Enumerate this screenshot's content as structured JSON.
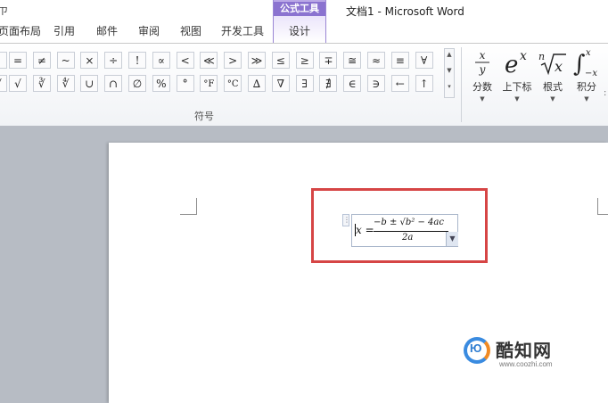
{
  "window": {
    "title": "文档1 - Microsoft Word"
  },
  "tabs": [
    "页面布局",
    "引用",
    "邮件",
    "审阅",
    "视图",
    "开发工具"
  ],
  "contextual": {
    "group_title": "公式工具",
    "tab": "设计"
  },
  "left_cut_glyph": "ㄗ",
  "symbols": {
    "row1": [
      "=",
      "≠",
      "~",
      "×",
      "÷",
      "!",
      "∝",
      "<",
      "≪",
      ">",
      "≫",
      "≤",
      "≥",
      "∓",
      "≅",
      "≈",
      "≡",
      "∀"
    ],
    "row2": [
      "√",
      "∛",
      "∜",
      "∪",
      "∩",
      "∅",
      "%",
      "°",
      "°F",
      "°C",
      "∆",
      "∇",
      "∃",
      "∄",
      "∈",
      "∋",
      "←",
      "↑"
    ],
    "left_partial_row1": "-",
    "left_partial_row2": "√",
    "group_label": "符号"
  },
  "structures": [
    {
      "label": "分数",
      "icon": "fraction-icon"
    },
    {
      "label": "上下标",
      "icon": "script-icon"
    },
    {
      "label": "根式",
      "icon": "radical-icon"
    },
    {
      "label": "积分",
      "icon": "integral-icon"
    }
  ],
  "document": {
    "equation": {
      "lhs": "x =",
      "numerator": "−b ± √b² − 4ac",
      "denominator": "2a"
    }
  },
  "watermark": {
    "brand": "酷知网",
    "url": "www.coozhi.com",
    "logo": "Ю"
  },
  "colors": {
    "highlight": "#d64545",
    "contextual_tab": "#8b73d0",
    "watermark_blue": "#3a8be0"
  }
}
